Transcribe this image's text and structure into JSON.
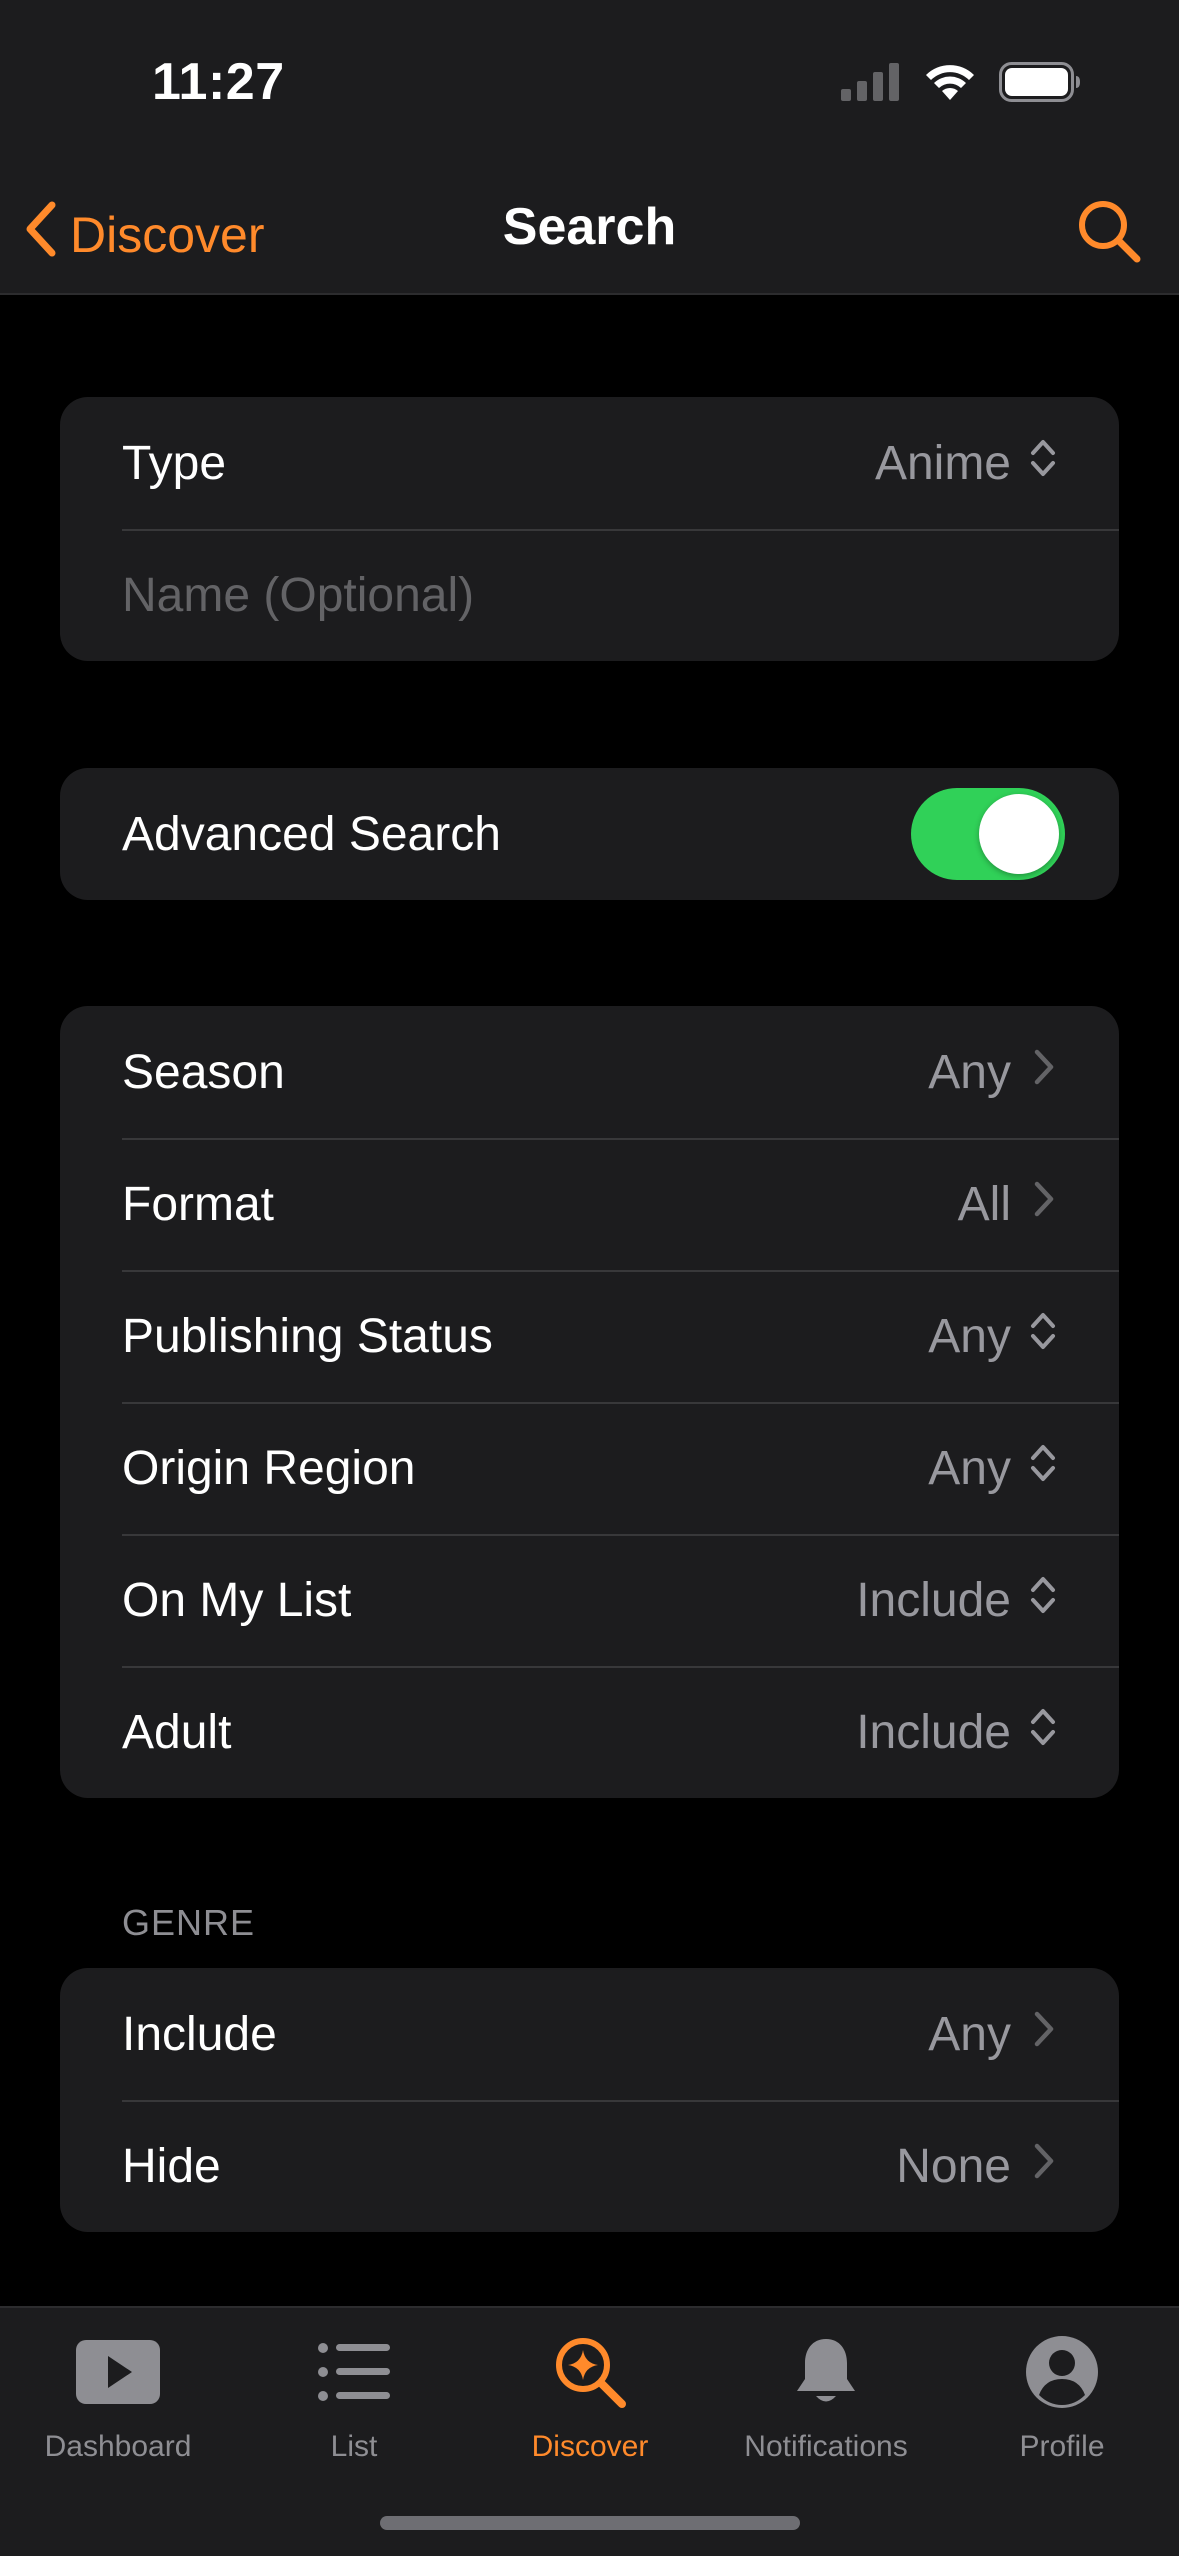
{
  "status_bar": {
    "time": "11:27"
  },
  "nav": {
    "back_label": "Discover",
    "title": "Search"
  },
  "basic": {
    "type_label": "Type",
    "type_value": "Anime",
    "name_placeholder": "Name (Optional)"
  },
  "advanced": {
    "label": "Advanced Search",
    "enabled": true
  },
  "filters": [
    {
      "label": "Season",
      "value": "Any",
      "control": "chevron"
    },
    {
      "label": "Format",
      "value": "All",
      "control": "chevron"
    },
    {
      "label": "Publishing Status",
      "value": "Any",
      "control": "updown"
    },
    {
      "label": "Origin Region",
      "value": "Any",
      "control": "updown"
    },
    {
      "label": "On My List",
      "value": "Include",
      "control": "updown"
    },
    {
      "label": "Adult",
      "value": "Include",
      "control": "updown"
    }
  ],
  "genre": {
    "header": "GENRE",
    "rows": [
      {
        "label": "Include",
        "value": "Any"
      },
      {
        "label": "Hide",
        "value": "None"
      }
    ]
  },
  "tabs": [
    {
      "label": "Dashboard",
      "icon": "play-icon"
    },
    {
      "label": "List",
      "icon": "list-icon"
    },
    {
      "label": "Discover",
      "icon": "discover-icon",
      "active": true
    },
    {
      "label": "Notifications",
      "icon": "bell-icon"
    },
    {
      "label": "Profile",
      "icon": "profile-icon"
    }
  ],
  "colors": {
    "accent": "#ff8a2b",
    "toggle_on": "#30d158",
    "background": "#000000",
    "card": "#1c1c1e"
  }
}
